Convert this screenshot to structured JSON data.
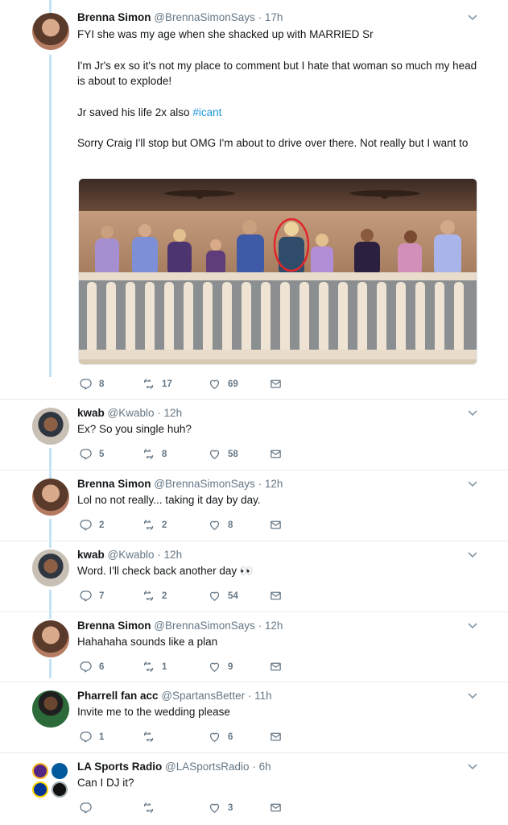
{
  "tweets": [
    {
      "name": "Brenna Simon",
      "handle": "@BrennaSimonSays",
      "time": "17h",
      "paragraphs": [
        "FYI she was my age when she shacked up with MARRIED Sr",
        "I'm Jr's ex so it's not my place to comment but I hate that woman so much my head is about to explode!",
        "Jr saved his life 2x also",
        "Sorry Craig I'll stop but OMG I'm about to drive over there. Not really but I want to"
      ],
      "hashtag": "#icant",
      "replies": "8",
      "retweets": "17",
      "likes": "69"
    },
    {
      "name": "kwab",
      "handle": "@Kwablo",
      "time": "12h",
      "text": "Ex? So you single huh?",
      "replies": "5",
      "retweets": "8",
      "likes": "58"
    },
    {
      "name": "Brenna Simon",
      "handle": "@BrennaSimonSays",
      "time": "12h",
      "text": "Lol no not really... taking it day by day.",
      "replies": "2",
      "retweets": "2",
      "likes": "8"
    },
    {
      "name": "kwab",
      "handle": "@Kwablo",
      "time": "12h",
      "text": "Word. I'll check back another day 👀",
      "replies": "7",
      "retweets": "2",
      "likes": "54"
    },
    {
      "name": "Brenna Simon",
      "handle": "@BrennaSimonSays",
      "time": "12h",
      "text": "Hahahaha sounds like a plan",
      "replies": "6",
      "retweets": "1",
      "likes": "9"
    },
    {
      "name": "Pharrell fan acc",
      "handle": "@SpartansBetter",
      "time": "11h",
      "text": "Invite me to the wedding please",
      "replies": "1",
      "retweets": "",
      "likes": "6"
    },
    {
      "name": "LA Sports Radio",
      "handle": "@LASportsRadio",
      "time": "6h",
      "text": "Can I DJ it?",
      "replies": "",
      "retweets": "",
      "likes": "3"
    }
  ],
  "separator": "·",
  "colors": {
    "link": "#1b95e0",
    "thread": "#c4e3f5",
    "muted": "#657786",
    "highlight_circle": "#e0262b"
  },
  "icons": {
    "reply": "reply-icon",
    "retweet": "retweet-icon",
    "like": "heart-icon",
    "dm": "envelope-icon",
    "more": "chevron-down-icon"
  }
}
